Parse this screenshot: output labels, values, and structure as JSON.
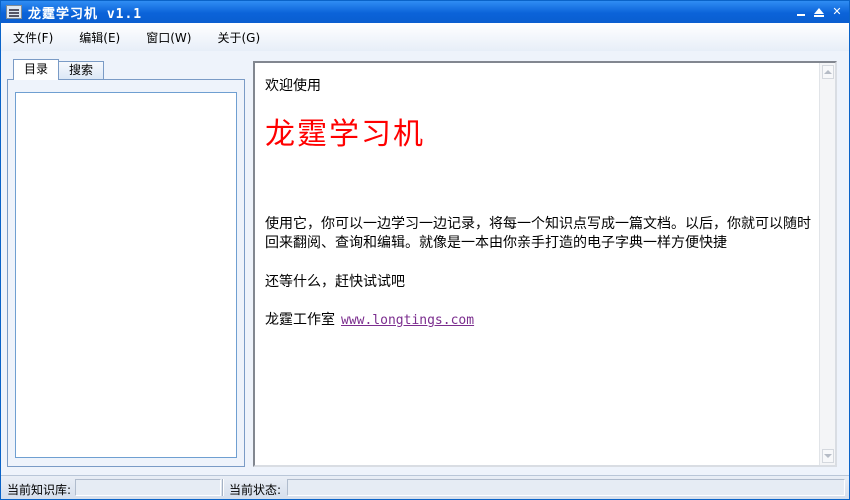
{
  "window": {
    "title": "龙霆学习机  v1.1"
  },
  "menu": {
    "items": [
      {
        "label": "文件(F)"
      },
      {
        "label": "编辑(E)"
      },
      {
        "label": "窗口(W)"
      },
      {
        "label": "关于(G)"
      }
    ]
  },
  "sidebar": {
    "tabs": [
      {
        "label": "目录",
        "active": true
      },
      {
        "label": "搜索",
        "active": false
      }
    ]
  },
  "content": {
    "welcome": "欢迎使用",
    "title": "龙霆学习机",
    "title_color": "#ff0000",
    "paragraph": "使用它，你可以一边学习一边记录，将每一个知识点写成一篇文档。以后，你就可以随时回来翻阅、查询和编辑。就像是一本由你亲手打造的电子字典一样方便快捷",
    "call_to_action": "还等什么，赶快试试吧",
    "studio": "龙霆工作室",
    "website": "www.longtings.com"
  },
  "statusbar": {
    "knowledge_base_label": "当前知识库:",
    "knowledge_base_value": "",
    "status_label": "当前状态:",
    "status_value": ""
  },
  "colors": {
    "titlebar": "#0b63d9",
    "link": "#7b2d8e"
  }
}
